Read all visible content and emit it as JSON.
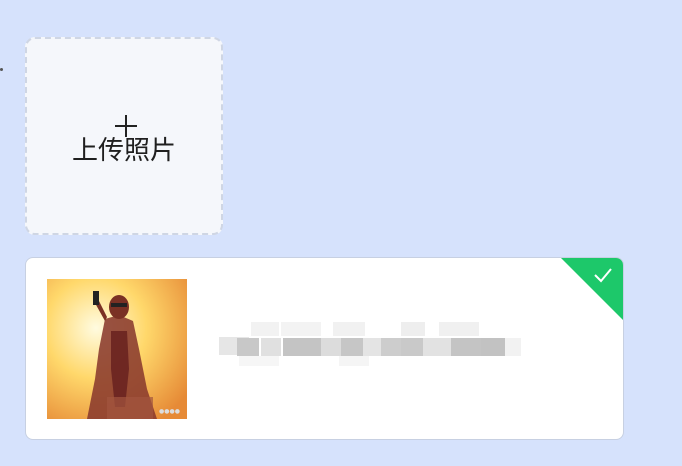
{
  "upload": {
    "icon": "plus-icon",
    "label": "上传照片"
  },
  "file": {
    "name": "",
    "status": "success",
    "status_icon": "check-icon",
    "status_color": "#1dc86a"
  },
  "colors": {
    "background": "#d6e2fc",
    "tile": "#f5f7fb",
    "success": "#1dc86a"
  }
}
